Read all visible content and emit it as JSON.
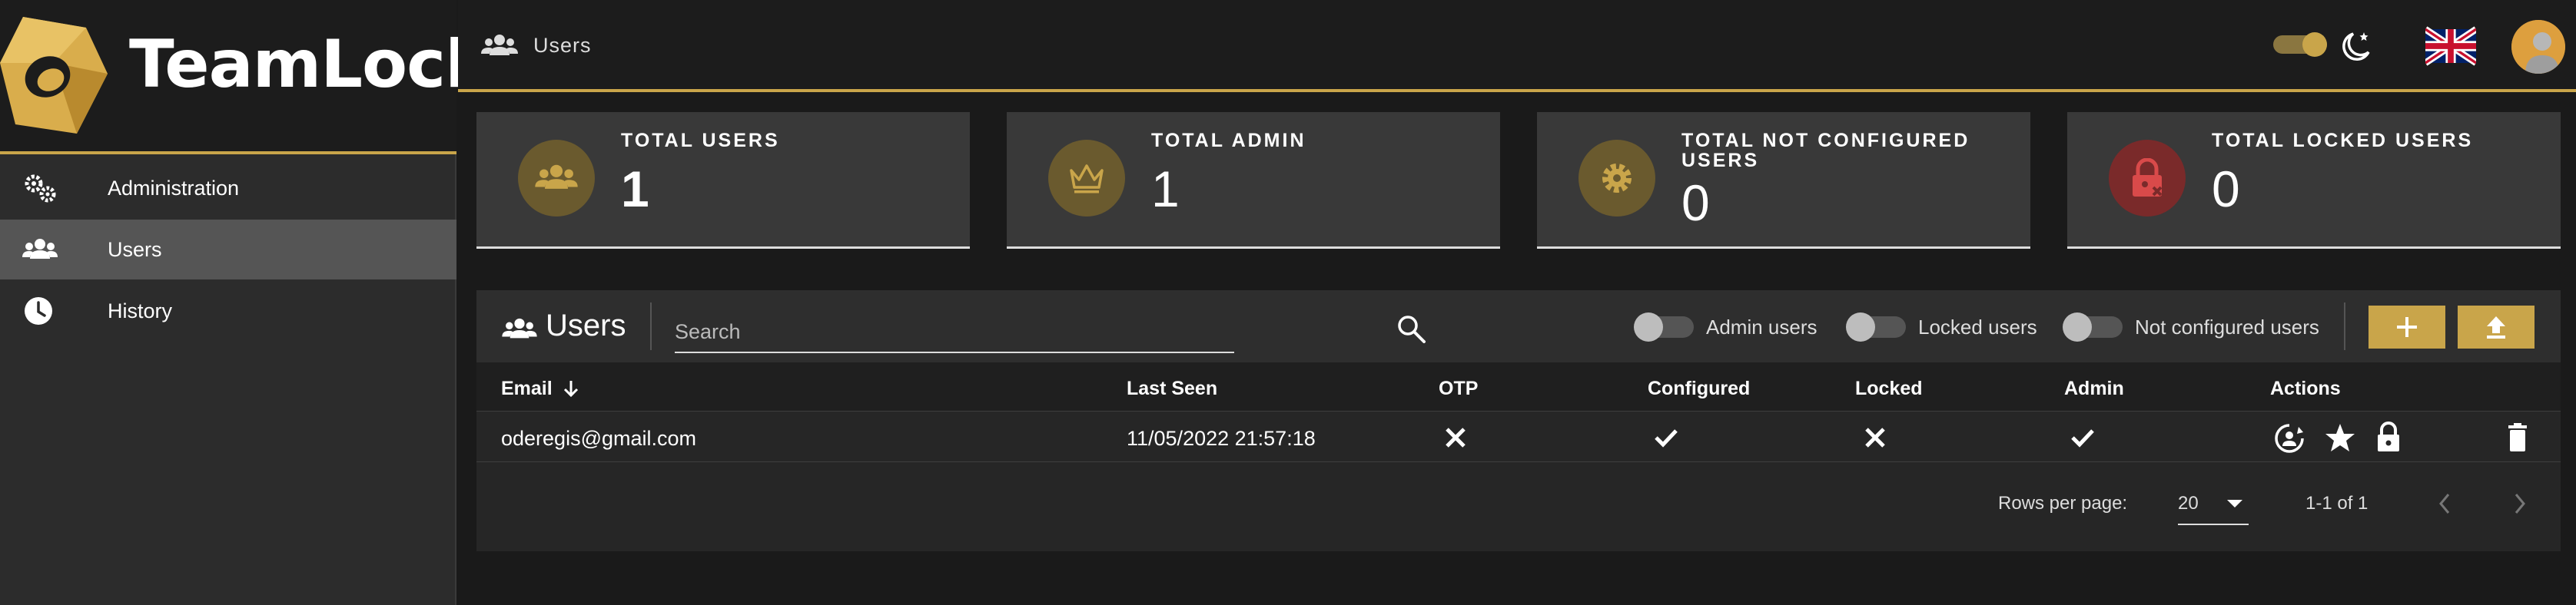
{
  "brand": {
    "name": "TeamLock"
  },
  "sidebar": {
    "items": [
      {
        "label": "Administration",
        "icon": "gears-icon"
      },
      {
        "label": "Users",
        "icon": "users-icon",
        "active": true
      },
      {
        "label": "History",
        "icon": "clock-icon"
      }
    ]
  },
  "header": {
    "title": "Users"
  },
  "stats": [
    {
      "title": "TOTAL USERS",
      "value": "1",
      "icon": "users-icon"
    },
    {
      "title": "TOTAL ADMIN",
      "value": "1",
      "icon": "crown-icon"
    },
    {
      "title": "TOTAL NOT CONFIGURED USERS",
      "value": "0",
      "icon": "gear-icon"
    },
    {
      "title": "TOTAL LOCKED USERS",
      "value": "0",
      "icon": "lock-x-icon"
    }
  ],
  "table": {
    "title": "Users",
    "search_placeholder": "Search",
    "filters": {
      "admin": "Admin users",
      "locked": "Locked users",
      "not_configured": "Not configured users"
    },
    "columns": {
      "email": "Email",
      "last_seen": "Last Seen",
      "otp": "OTP",
      "configured": "Configured",
      "locked": "Locked",
      "admin": "Admin",
      "actions": "Actions"
    },
    "rows": [
      {
        "email": "oderegis@gmail.com",
        "last_seen": "11/05/2022 21:57:18",
        "otp": false,
        "configured": true,
        "locked": false,
        "admin": true
      }
    ],
    "footer": {
      "rows_per_page_label": "Rows per page:",
      "rows_per_page": "20",
      "range": "1-1 of 1"
    }
  },
  "colors": {
    "accent": "#c9a54a",
    "background": "#1a1a1a",
    "sidebar": "#2c2c2c",
    "card": "#393939"
  }
}
